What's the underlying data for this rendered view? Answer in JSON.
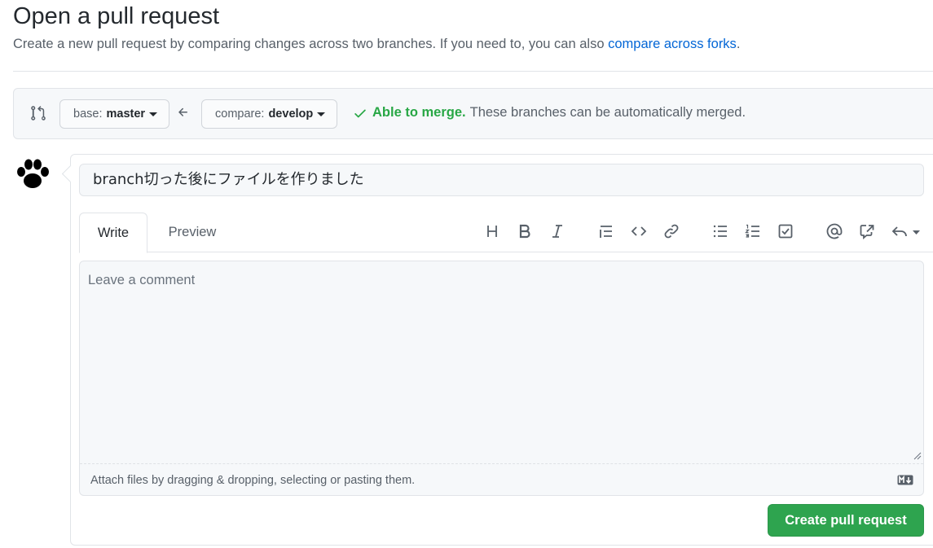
{
  "header": {
    "title": "Open a pull request",
    "subtitle": "Create a new pull request by comparing changes across two branches. If you need to, you can also ",
    "subtitle_link": "compare across forks",
    "subtitle_end": "."
  },
  "range": {
    "base_prefix": "base:",
    "base_branch": "master",
    "compare_prefix": "compare:",
    "compare_branch": "develop",
    "merge_status_bold": "Able to merge.",
    "merge_status_text": "These branches can be automatically merged."
  },
  "form": {
    "title_value": "branch切った後にファイルを作りました",
    "tabs": [
      {
        "label": "Write",
        "active": true
      },
      {
        "label": "Preview",
        "active": false
      }
    ],
    "toolbar_icons": [
      "heading-icon",
      "bold-icon",
      "italic-icon",
      "quote-icon",
      "code-icon",
      "link-icon",
      "unordered-list-icon",
      "ordered-list-icon",
      "task-list-icon",
      "mention-icon",
      "reference-icon",
      "reply-icon"
    ],
    "comment_placeholder": "Leave a comment",
    "attach_hint": "Attach files by dragging & dropping, selecting or pasting them.",
    "submit_label": "Create pull request"
  },
  "colors": {
    "accent_link": "#0366d6",
    "success_green": "#28a745",
    "button_green": "#2ea44f"
  }
}
